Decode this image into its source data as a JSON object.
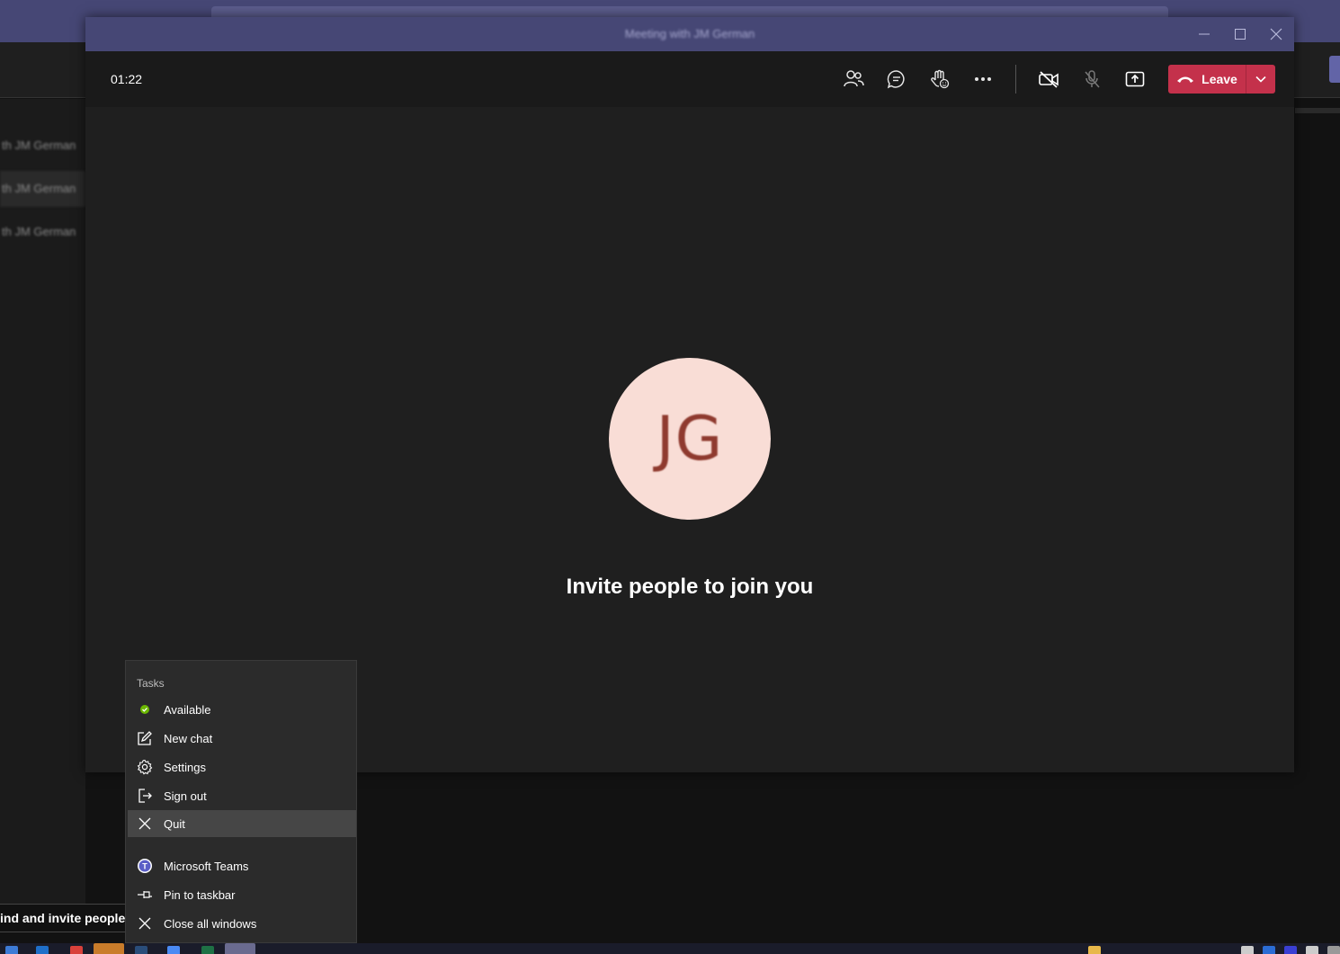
{
  "background": {
    "chat_items": [
      "th JM German",
      "th JM German",
      "th JM German"
    ],
    "invite_button": "ind and invite people"
  },
  "meeting": {
    "window_title": "Meeting with JM German",
    "timer": "01:22",
    "leave_label": "Leave",
    "avatar_initials": "JG",
    "invite_heading": "Invite people to join you"
  },
  "jumplist": {
    "tasks_header": "Tasks",
    "tasks": [
      {
        "label": "Available",
        "icon": "available-status-icon"
      },
      {
        "label": "New chat",
        "icon": "new-chat-icon"
      },
      {
        "label": "Settings",
        "icon": "gear-icon"
      },
      {
        "label": "Sign out",
        "icon": "sign-out-icon"
      },
      {
        "label": "Quit",
        "icon": "close-icon"
      }
    ],
    "app_items": [
      {
        "label": "Microsoft Teams",
        "icon": "teams-icon"
      },
      {
        "label": "Pin to taskbar",
        "icon": "pin-icon"
      },
      {
        "label": "Close all windows",
        "icon": "close-icon"
      }
    ]
  },
  "colors": {
    "teams_purple": "#464775",
    "leave_red": "#c4314b",
    "available_green": "#6bb700",
    "avatar_bg": "#f9ddd6"
  }
}
